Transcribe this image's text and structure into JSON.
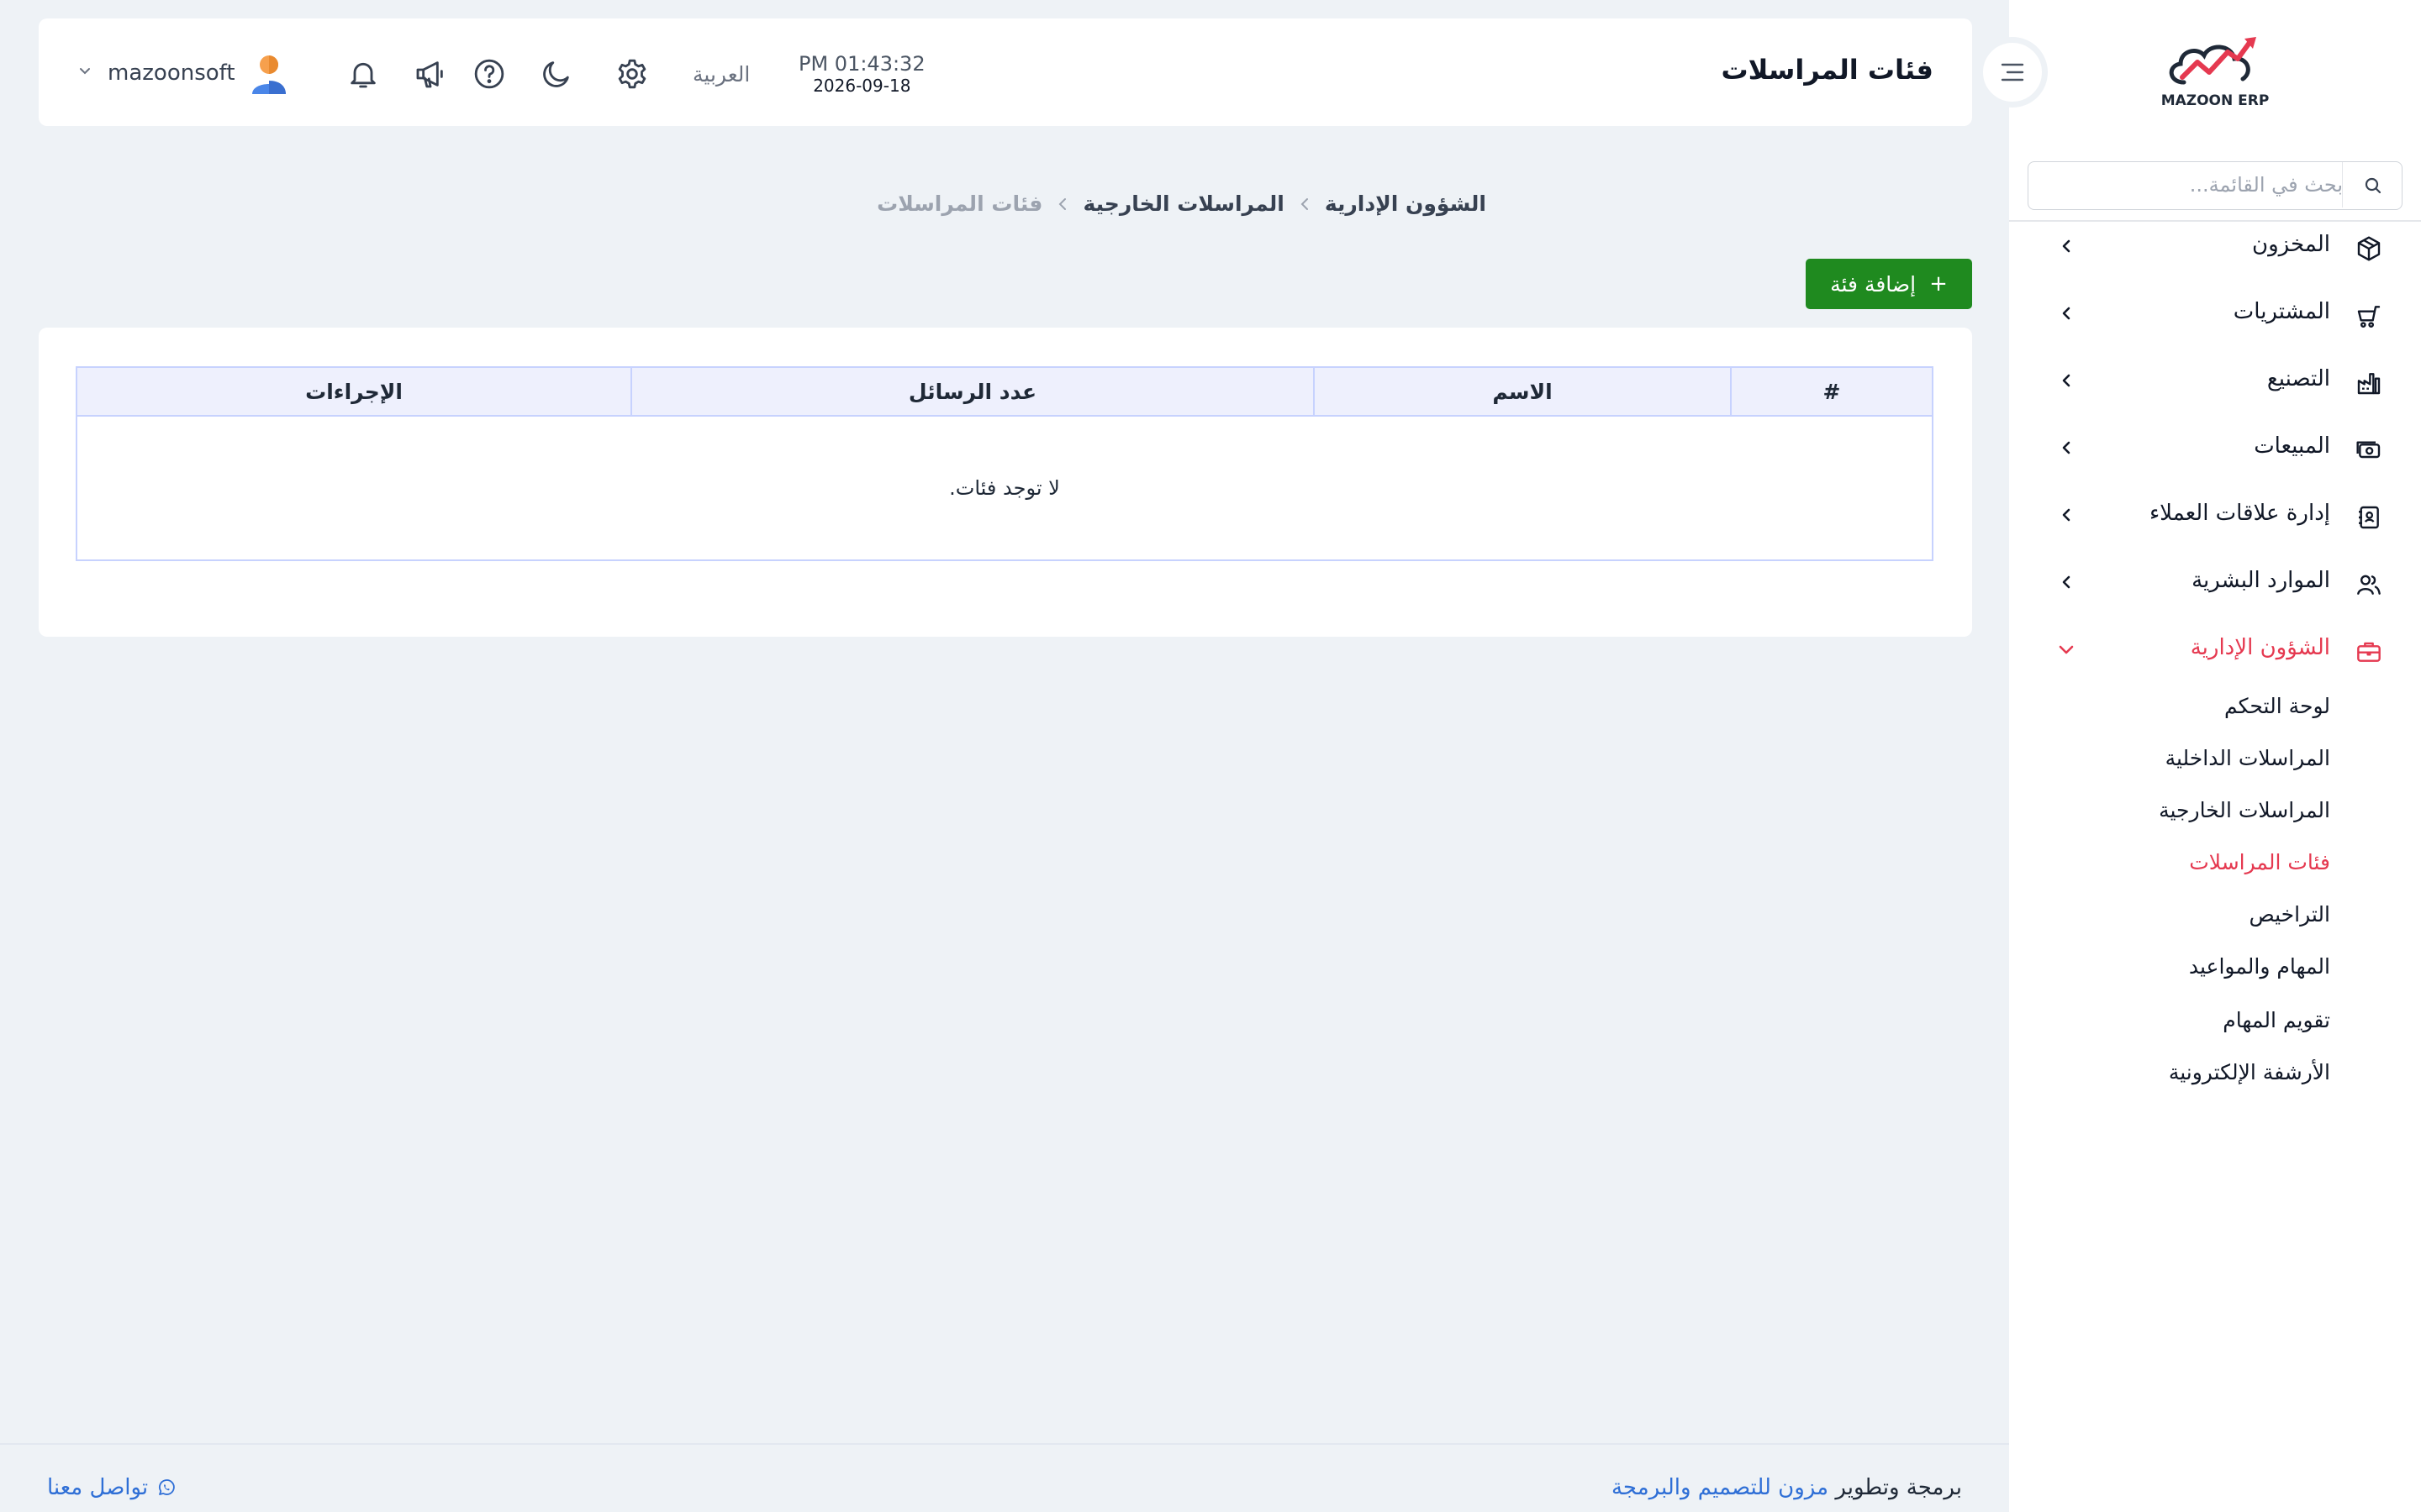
{
  "app": {
    "logo_text": "MAZOON ERP",
    "brand_colors": {
      "accent": "#e53950",
      "primary_button": "#1f8a1f",
      "link": "#2f6fd6"
    }
  },
  "sidebar": {
    "search_placeholder": "بحث في القائمة...",
    "items": [
      {
        "label": "المخزون",
        "icon": "box-icon"
      },
      {
        "label": "المشتريات",
        "icon": "cart-icon"
      },
      {
        "label": "التصنيع",
        "icon": "factory-icon"
      },
      {
        "label": "المبيعات",
        "icon": "cash-icon"
      },
      {
        "label": "إدارة علاقات العملاء",
        "icon": "contacts-book-icon"
      },
      {
        "label": "الموارد البشرية",
        "icon": "users-icon"
      },
      {
        "label": "الشؤون الإدارية",
        "icon": "briefcase-icon"
      }
    ],
    "subitems": [
      "لوحة التحكم",
      "المراسلات الداخلية",
      "المراسلات الخارجية",
      "فئات المراسلات",
      "التراخيص",
      "المهام والمواعيد",
      "تقويم المهام",
      "الأرشفة الإلكترونية"
    ]
  },
  "header": {
    "page_title": "فئات المراسلات",
    "time": "PM 01:43:32",
    "date": "2026-09-18",
    "language": "العربية",
    "username": "mazoonsoft"
  },
  "breadcrumb": [
    "الشؤون الإدارية",
    "المراسلات الخارجية",
    "فئات المراسلات"
  ],
  "actions": {
    "add_label": "إضافة فئة",
    "add_icon": "+"
  },
  "table": {
    "columns": [
      "#",
      "الاسم",
      "عدد الرسائل",
      "الإجراءات"
    ],
    "rows": [],
    "empty_message": "لا توجد فئات."
  },
  "footer": {
    "credit_prefix": "برمجة وتطوير",
    "credit_link": "مزون للتصميم والبرمجة",
    "contact": "تواصل معنا"
  }
}
